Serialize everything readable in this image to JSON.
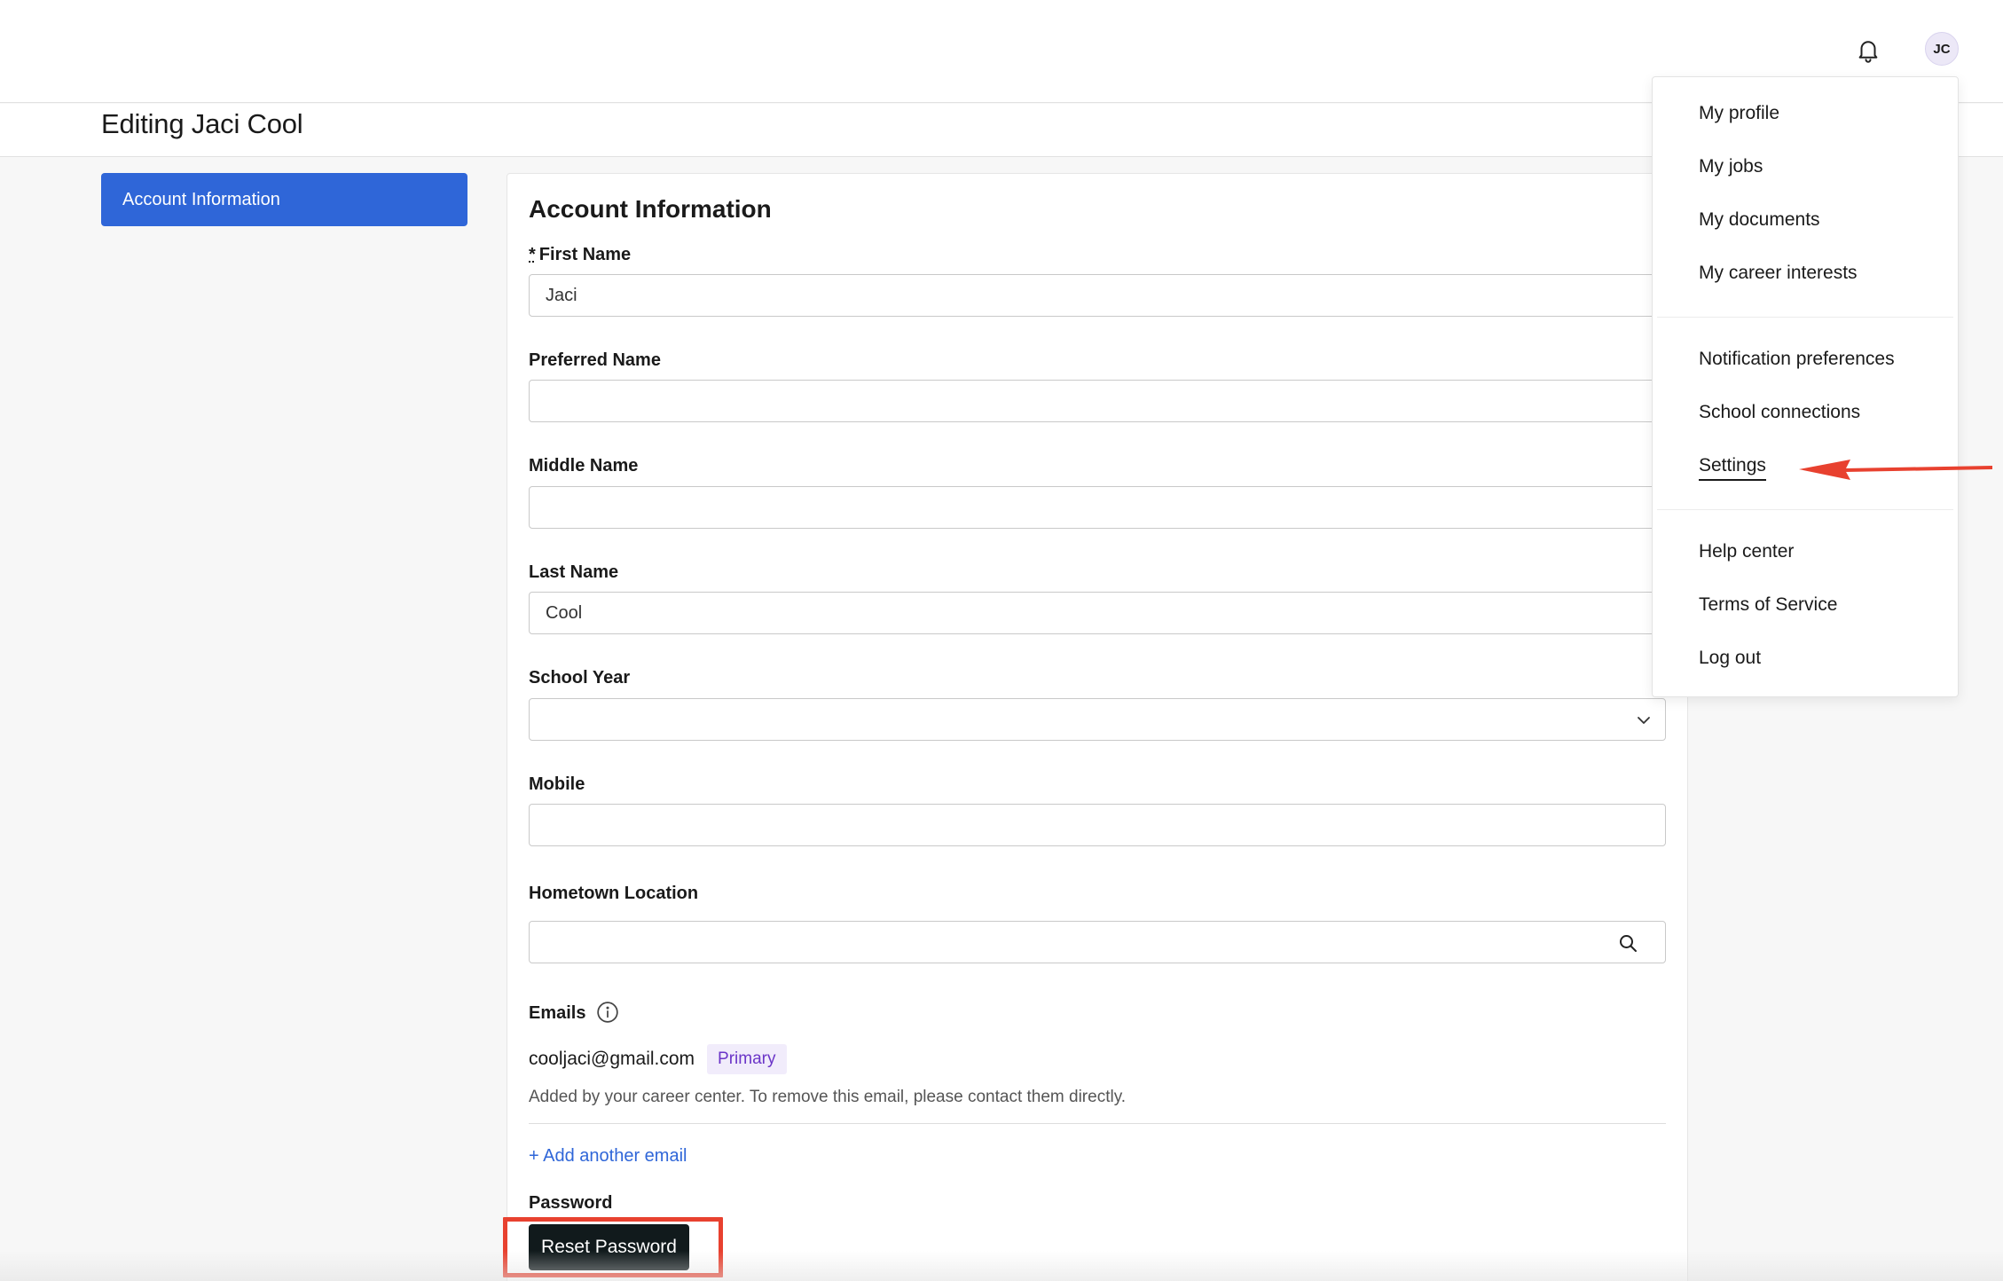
{
  "header": {
    "page_title": "Editing Jaci Cool",
    "avatar_initials": "JC"
  },
  "sidebar": {
    "items": [
      {
        "label": "Account Information",
        "active": true
      }
    ]
  },
  "form": {
    "title": "Account Information",
    "required_marker": "*",
    "fields": {
      "first_name": {
        "label": "First Name",
        "value": "Jaci"
      },
      "preferred_name": {
        "label": "Preferred Name",
        "value": ""
      },
      "middle_name": {
        "label": "Middle Name",
        "value": ""
      },
      "last_name": {
        "label": "Last Name",
        "value": "Cool"
      },
      "school_year": {
        "label": "School Year",
        "value": ""
      },
      "mobile": {
        "label": "Mobile",
        "value": ""
      },
      "hometown": {
        "label": "Hometown Location",
        "value": ""
      }
    },
    "emails": {
      "label": "Emails",
      "address": "cooljaci@gmail.com",
      "badge": "Primary",
      "note": "Added by your career center. To remove this email, please contact them directly.",
      "add_link": "+ Add another email"
    },
    "password": {
      "label": "Password",
      "reset_button": "Reset Password"
    }
  },
  "user_menu": {
    "group1": [
      "My profile",
      "My jobs",
      "My documents",
      "My career interests"
    ],
    "group2": [
      "Notification preferences",
      "School connections",
      "Settings"
    ],
    "group3": [
      "Help center",
      "Terms of Service",
      "Log out"
    ],
    "active_item": "Settings"
  },
  "colors": {
    "accent": "#2f66d8",
    "badge_text": "#6b35c8",
    "badge_bg": "#f1ecfb",
    "highlight": "#e8412f",
    "button_dark": "#111a1c"
  },
  "icons": {
    "bell": "bell-icon",
    "chevron": "chevron-down-icon",
    "search": "search-icon",
    "info": "info-icon",
    "arrow": "arrow-left-annotation"
  }
}
